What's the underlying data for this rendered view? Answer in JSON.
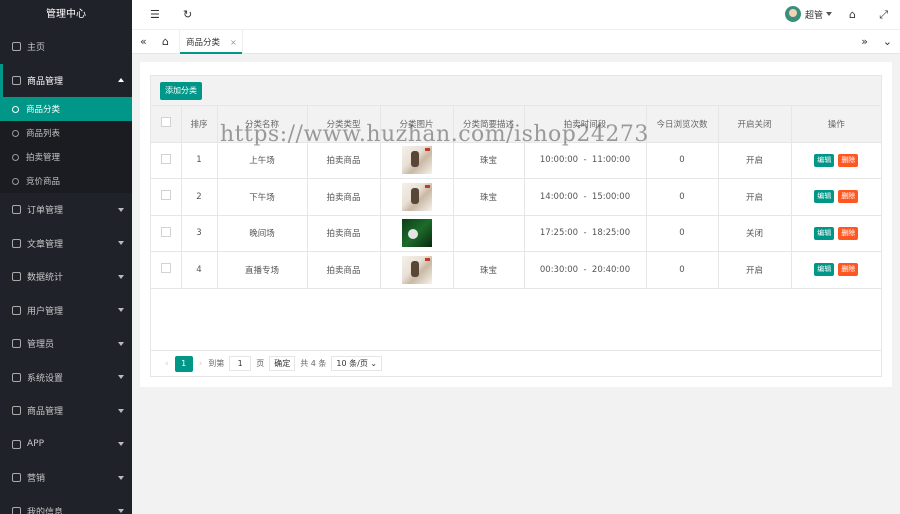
{
  "sidebar": {
    "title": "管理中心",
    "home": "主页",
    "group_open": {
      "label": "商品管理",
      "children": [
        "商品分类",
        "商品列表",
        "拍卖管理",
        "竞价商品"
      ],
      "active_index": 0
    },
    "groups": [
      "订单管理",
      "文章管理",
      "数据统计",
      "用户管理",
      "管理员",
      "系统设置",
      "商品管理",
      "APP",
      "营销",
      "我的信息"
    ]
  },
  "topbar": {
    "user_name": "超管"
  },
  "tabs": {
    "active_label": "商品分类",
    "close": "×"
  },
  "toolbar": {
    "add_label": "添加分类"
  },
  "table": {
    "headers": [
      "排序",
      "分类名称",
      "分类类型",
      "分类图片",
      "分类简要描述",
      "拍卖时间段",
      "今日浏览次数",
      "开启关闭",
      "操作"
    ],
    "rows": [
      {
        "sort": "1",
        "name": "上午场",
        "type": "拍卖商品",
        "image": "light",
        "desc": "珠宝",
        "time": "10:00:00  -  11:00:00",
        "views": "0",
        "status": "开启"
      },
      {
        "sort": "2",
        "name": "下午场",
        "type": "拍卖商品",
        "image": "light",
        "desc": "珠宝",
        "time": "14:00:00  -  15:00:00",
        "views": "0",
        "status": "开启"
      },
      {
        "sort": "3",
        "name": "晚间场",
        "type": "拍卖商品",
        "image": "dark",
        "desc": "",
        "time": "17:25:00  -  18:25:00",
        "views": "0",
        "status": "关闭"
      },
      {
        "sort": "4",
        "name": "直播专场",
        "type": "拍卖商品",
        "image": "light",
        "desc": "珠宝",
        "time": "00:30:00  -  20:40:00",
        "views": "0",
        "status": "开启"
      }
    ],
    "edit_label": "编辑",
    "delete_label": "删除"
  },
  "pager": {
    "current": "1",
    "goto_label": "到第",
    "page_input": "1",
    "page_unit": "页",
    "confirm": "确定",
    "total": "共 4 条",
    "page_size": "10 条/页"
  },
  "watermark": "https://www.huzhan.com/ishop24273",
  "colors": {
    "accent": "#009688",
    "danger": "#ff5722",
    "sidebar_bg": "#20222a"
  }
}
